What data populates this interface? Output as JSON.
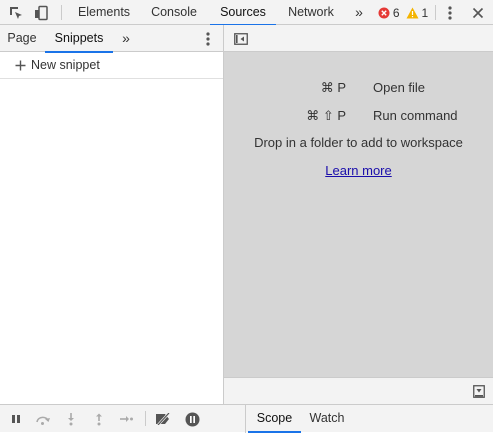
{
  "toolbar": {
    "tabs": [
      {
        "label": "Elements"
      },
      {
        "label": "Console"
      },
      {
        "label": "Sources",
        "active": true
      },
      {
        "label": "Network"
      }
    ],
    "more_tabs_label": "»",
    "error_count": "6",
    "warning_count": "1",
    "icons": [
      "inspect-element-icon",
      "device-toolbar-icon",
      "errors-icon",
      "warnings-icon",
      "kebab-menu-icon",
      "close-icon"
    ]
  },
  "navigator": {
    "tabs": [
      {
        "label": "Page"
      },
      {
        "label": "Snippets",
        "active": true
      }
    ],
    "more_label": "»",
    "new_snippet_label": "New snippet"
  },
  "editor": {
    "shortcuts": [
      {
        "keys": "⌘ P",
        "label": "Open file"
      },
      {
        "keys": "⌘ ⇧ P",
        "label": "Run command"
      }
    ],
    "drop_text": "Drop in a folder to add to workspace",
    "learn_more_label": "Learn more"
  },
  "debugger": {
    "tabs": [
      {
        "label": "Scope",
        "active": true
      },
      {
        "label": "Watch"
      }
    ]
  },
  "colors": {
    "accent": "#1a73e8",
    "error": "#e53935",
    "warning": "#f4b400",
    "editor_bg": "#d6d6d6",
    "toolbar_bg": "#f3f3f3",
    "link": "#1a0dab"
  }
}
